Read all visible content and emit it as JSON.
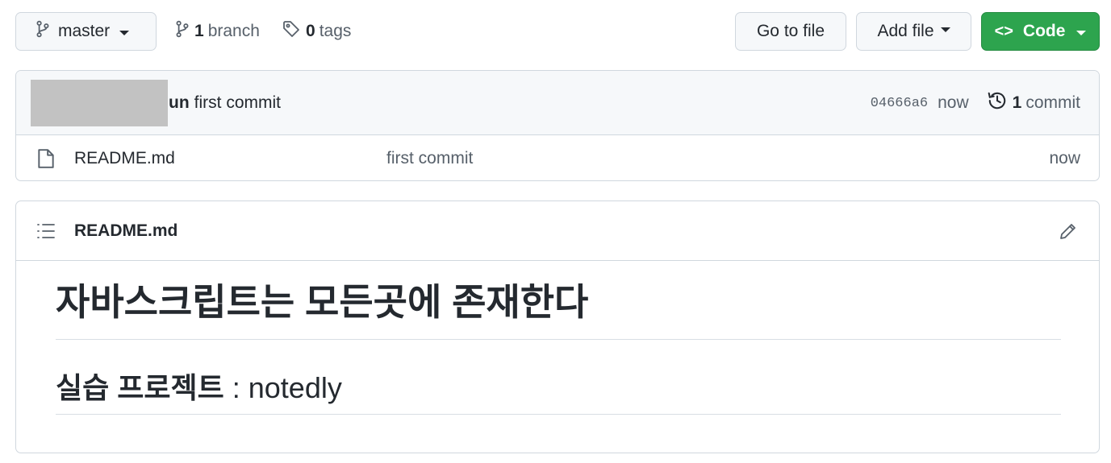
{
  "toolbar": {
    "branch_name": "master",
    "branch_count": "1",
    "branch_label": "branch",
    "tag_count": "0",
    "tag_label": "tags",
    "go_to_file": "Go to file",
    "add_file": "Add file",
    "code_glyph": "<>",
    "code": "Code",
    "code_button_color": "#2da44e"
  },
  "latest_commit": {
    "author": "un",
    "message": "first commit",
    "sha": "04666a6",
    "age": "now",
    "commit_count": "1",
    "commit_label": "commit"
  },
  "files": [
    {
      "name": "README.md",
      "message": "first commit",
      "age": "now",
      "icon": "file-icon"
    }
  ],
  "readme": {
    "filename": "README.md",
    "h1": "자바스크립트는 모든곳에 존재한다",
    "h2_ko": "실습 프로젝트",
    "h2_en": ": notedly"
  }
}
